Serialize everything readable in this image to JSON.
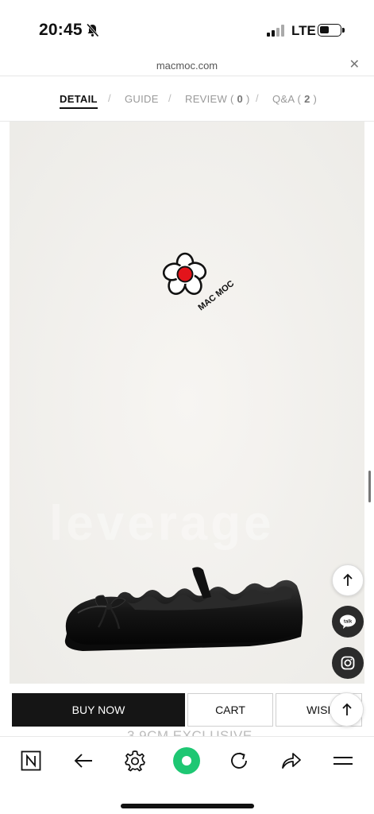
{
  "status": {
    "time": "20:45",
    "network": "LTE"
  },
  "browser": {
    "url": "macmoc.com"
  },
  "tabs": [
    {
      "label": "DETAIL"
    },
    {
      "label": "GUIDE"
    },
    {
      "label": "REVIEW",
      "count": "0"
    },
    {
      "label": "Q&A",
      "count": "2"
    }
  ],
  "product": {
    "brand_logo_text": "MAC MOC",
    "watermark": "leverage"
  },
  "actions": {
    "buy": "BUY NOW",
    "cart": "CART",
    "wish": "WISH"
  },
  "partial_text": "3.9CM EXCLUSIVE",
  "toolbar": [
    "naver-icon",
    "back-icon",
    "settings-icon",
    "home-icon",
    "refresh-icon",
    "share-icon",
    "menu-icon"
  ],
  "colors": {
    "accent": "#1ec773",
    "logo_red": "#e3141b",
    "dark_button": "#151515"
  }
}
